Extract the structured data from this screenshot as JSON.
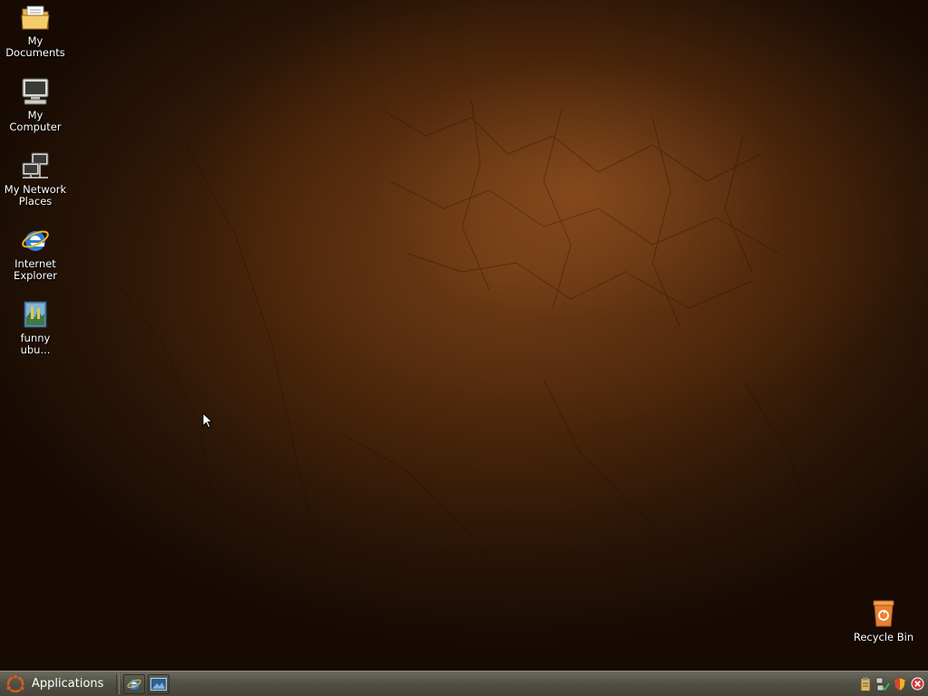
{
  "desktop": {
    "icons": [
      {
        "label": "My\nDocuments",
        "icon": "folder-documents-icon"
      },
      {
        "label": "My\nComputer",
        "icon": "computer-icon"
      },
      {
        "label": "My Network\nPlaces",
        "icon": "network-places-icon"
      },
      {
        "label": "Internet\nExplorer",
        "icon": "internet-explorer-icon"
      },
      {
        "label": "funny\nubu...",
        "icon": "image-file-icon"
      }
    ],
    "recycle_bin": {
      "label": "Recycle Bin",
      "icon": "recycle-bin-icon"
    }
  },
  "taskbar": {
    "applications_label": "Applications",
    "quick_launch": [
      {
        "icon": "internet-explorer-icon"
      },
      {
        "icon": "show-desktop-icon"
      }
    ],
    "tray": [
      {
        "icon": "clipboard-icon"
      },
      {
        "icon": "network-status-icon"
      },
      {
        "icon": "security-shield-icon"
      },
      {
        "icon": "close-error-icon"
      }
    ]
  },
  "colors": {
    "taskbar_bg": "#4f4f45",
    "ubuntu_orange": "#e0591c",
    "wallpaper_dark": "#160a03",
    "wallpaper_light": "#a85f28"
  }
}
